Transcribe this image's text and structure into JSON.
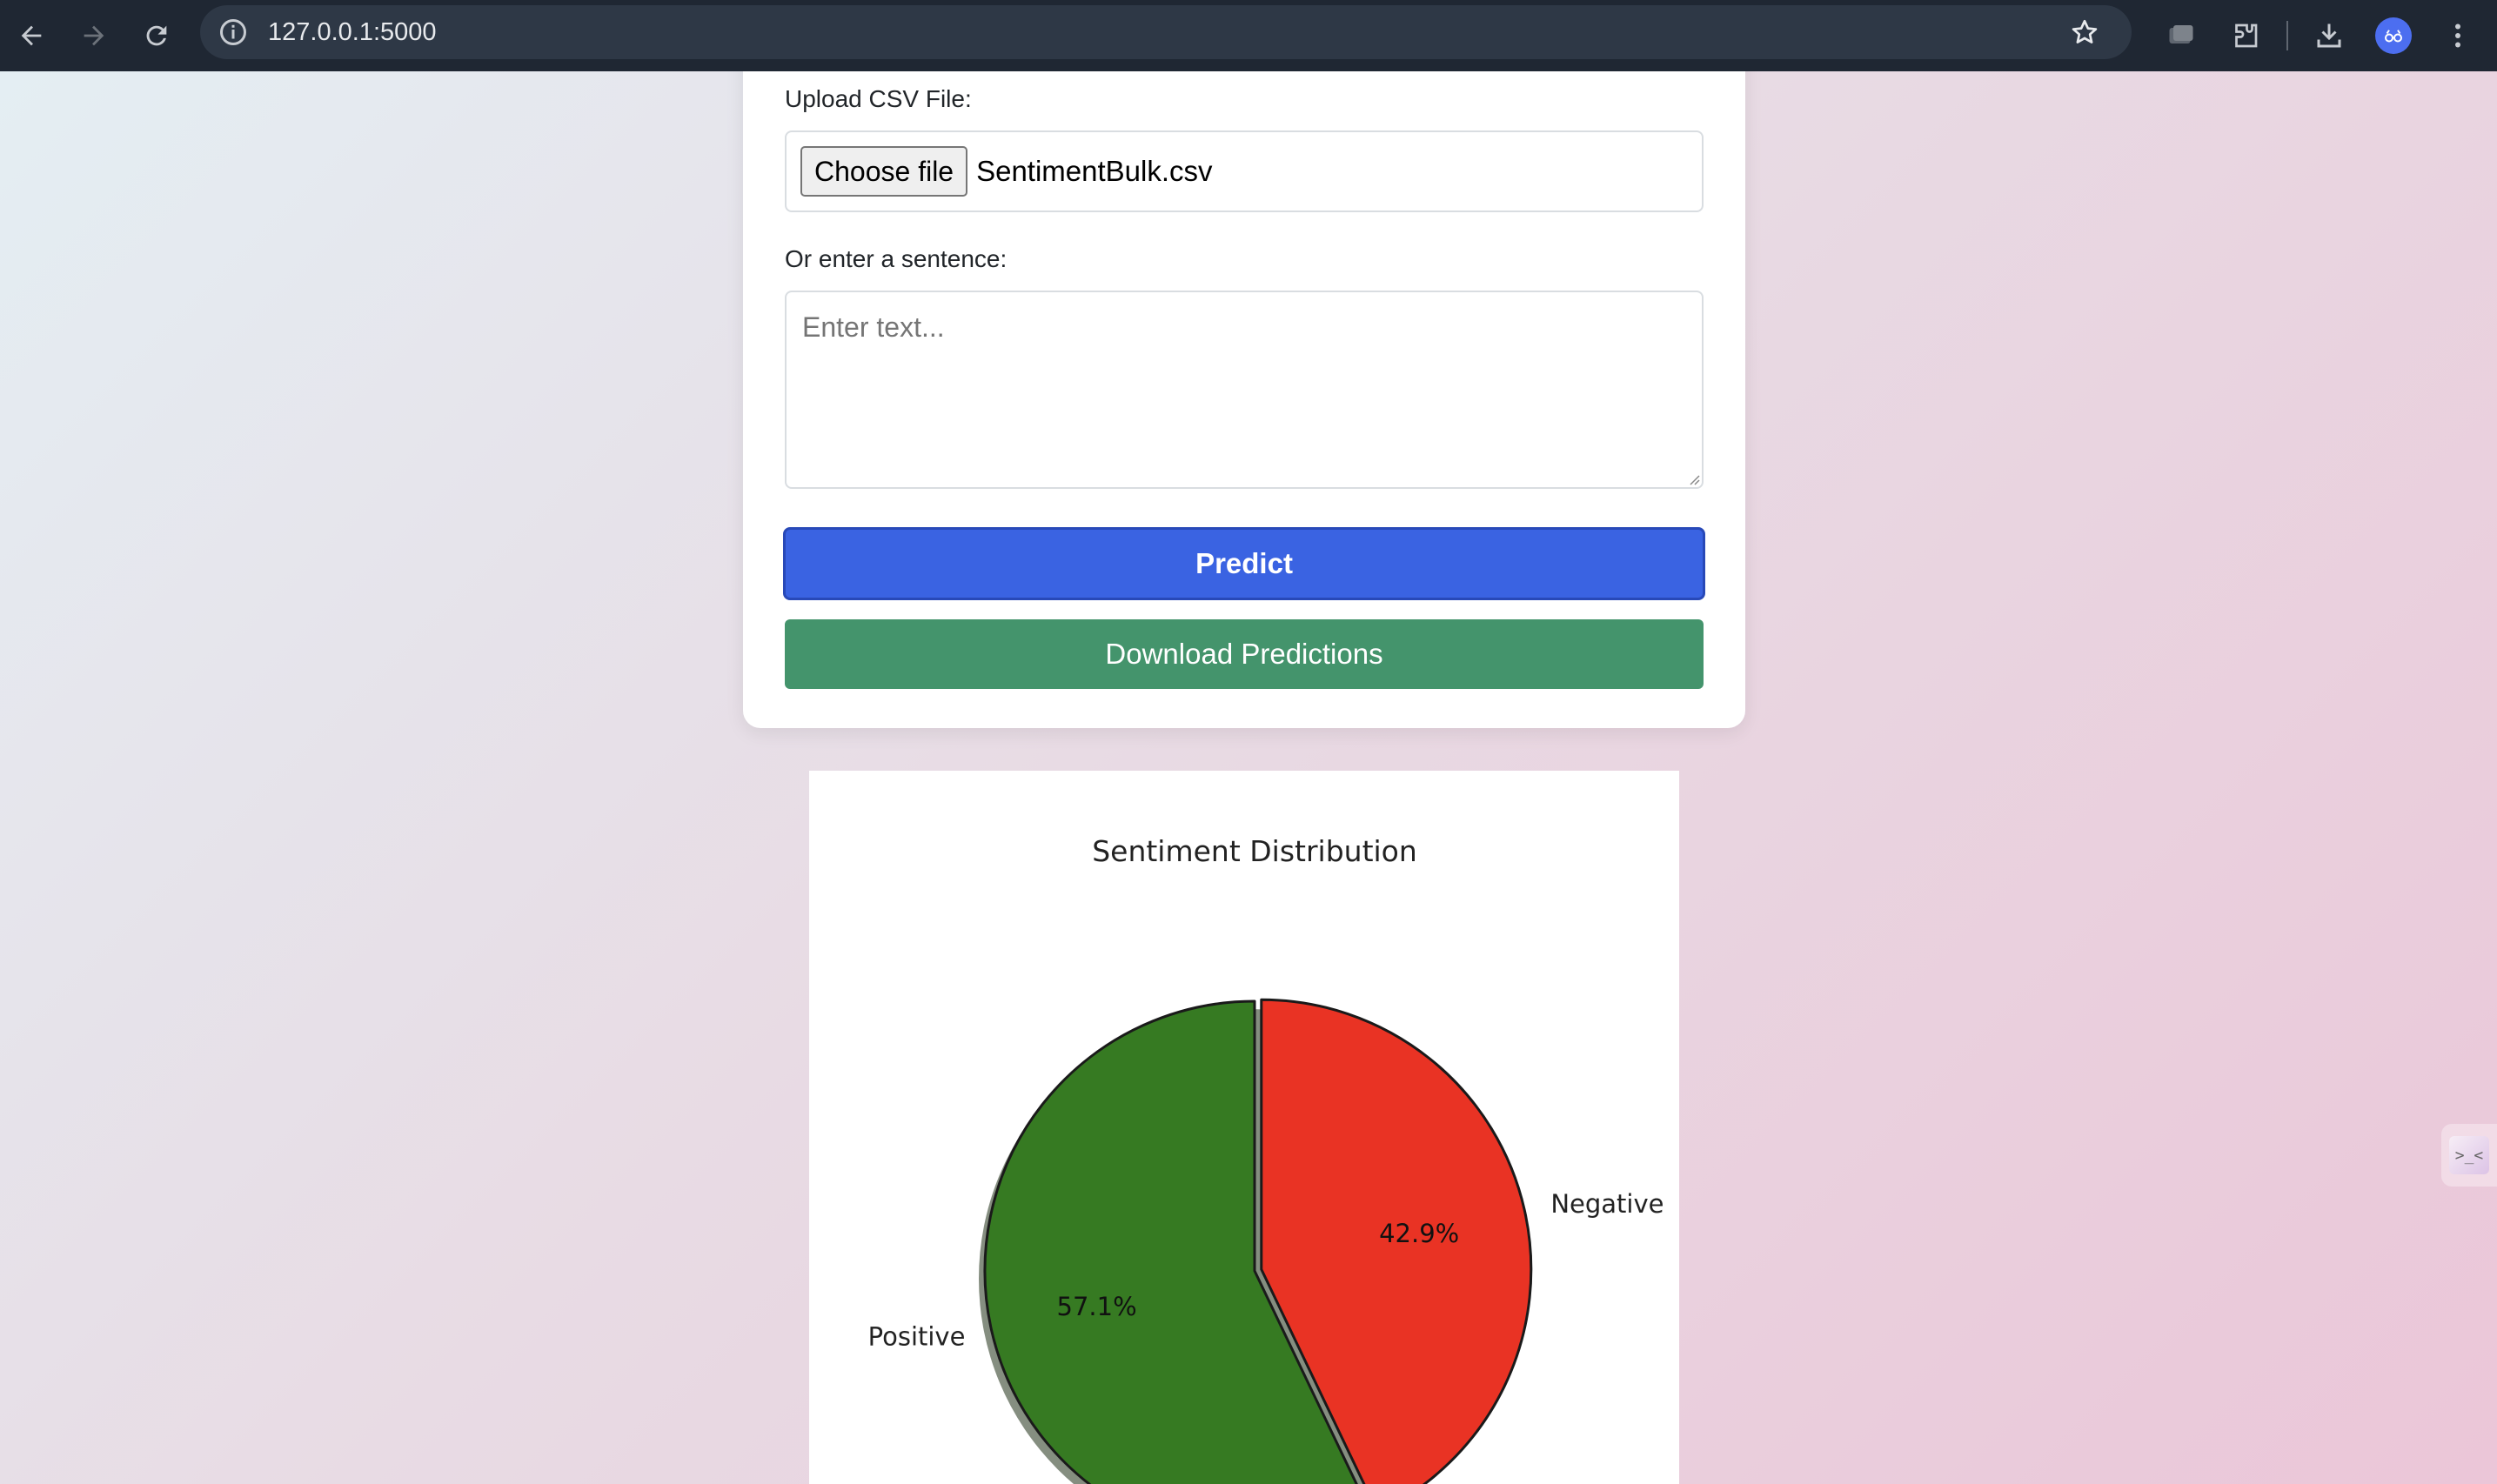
{
  "browser": {
    "url": "127.0.0.1:5000",
    "icons": [
      "back-arrow-icon",
      "forward-arrow-icon",
      "reload-icon",
      "site-info-icon",
      "bookmark-star-icon",
      "tab-search-icon",
      "extensions-icon",
      "download-icon",
      "profile-avatar-icon",
      "more-menu-icon"
    ]
  },
  "form": {
    "upload_label": "Upload CSV File:",
    "choose_file_label": "Choose file",
    "file_name": "SentimentBulk.csv",
    "sentence_label": "Or enter a sentence:",
    "text_placeholder": "Enter text...",
    "predict_label": "Predict",
    "download_label": "Download Predictions",
    "colors": {
      "predict": "#3a63e2",
      "download": "#44946c"
    }
  },
  "chart_data": {
    "type": "pie",
    "title": "Sentiment Distribution",
    "labels": [
      "Negative",
      "Positive"
    ],
    "values": [
      42.9,
      57.1
    ],
    "value_labels": [
      "42.9%",
      "57.1%"
    ],
    "colors": [
      "#e93324",
      "#367a22"
    ],
    "shadow": true
  },
  "side_widget": {
    "label": ">_<"
  }
}
